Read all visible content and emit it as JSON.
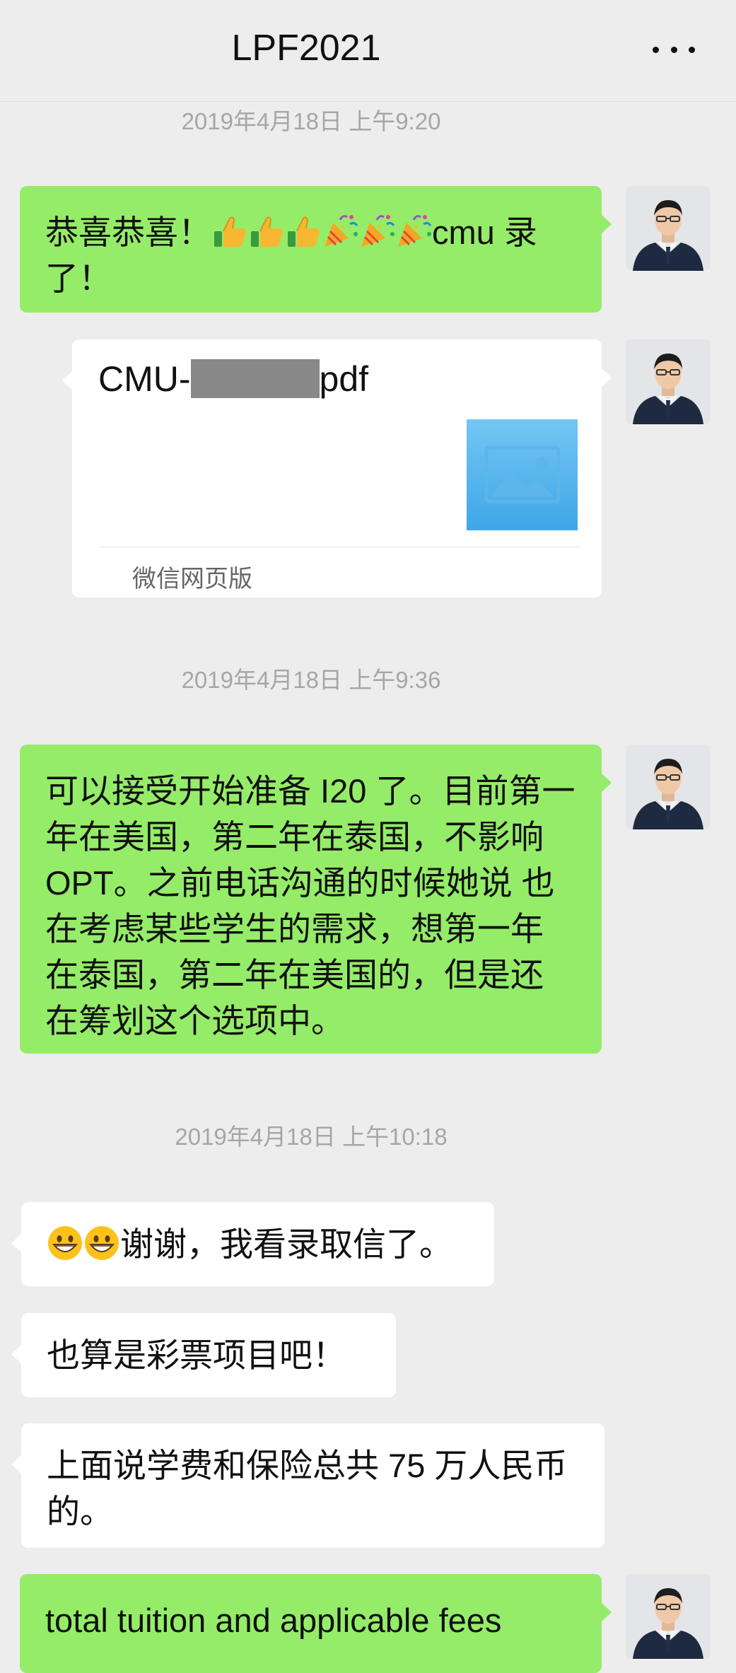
{
  "chat_title": "LPF2021",
  "timestamps": [
    "2019年4月18日 上午9:20",
    "2019年4月18日 上午9:36",
    "2019年4月18日 上午10:18"
  ],
  "messages": [
    {
      "side": "me",
      "text": "恭喜恭喜！",
      "suffix": "cmu 录了！",
      "emoji": [
        "thumbs-up",
        "thumbs-up",
        "thumbs-up",
        "party-popper",
        "party-popper",
        "party-popper"
      ]
    },
    {
      "side": "me",
      "type": "file_card",
      "file_prefix": "CMU-",
      "file_suffix": "pdf",
      "source": "微信网页版"
    },
    {
      "side": "me",
      "text": "可以接受开始准备 I20 了。目前第一年在美国，第二年在泰国，不影响 OPT。之前电话沟通的时候她说 也在考虑某些学生的需求，想第一年在泰国，第二年在美国的，但是还在筹划这个选项中。"
    },
    {
      "side": "them",
      "text": "谢谢，我看录取信了。",
      "emoji": [
        "grinning-face",
        "grinning-face"
      ]
    },
    {
      "side": "them",
      "text": "也算是彩票项目吧！"
    },
    {
      "side": "them",
      "text": "上面说学费和保险总共 75 万人民币的。"
    },
    {
      "side": "me",
      "text": "total tuition and applicable fees"
    }
  ],
  "colors": {
    "my_bubble": "#95ec69",
    "their_bubble": "#ffffff",
    "background": "#ededed"
  }
}
